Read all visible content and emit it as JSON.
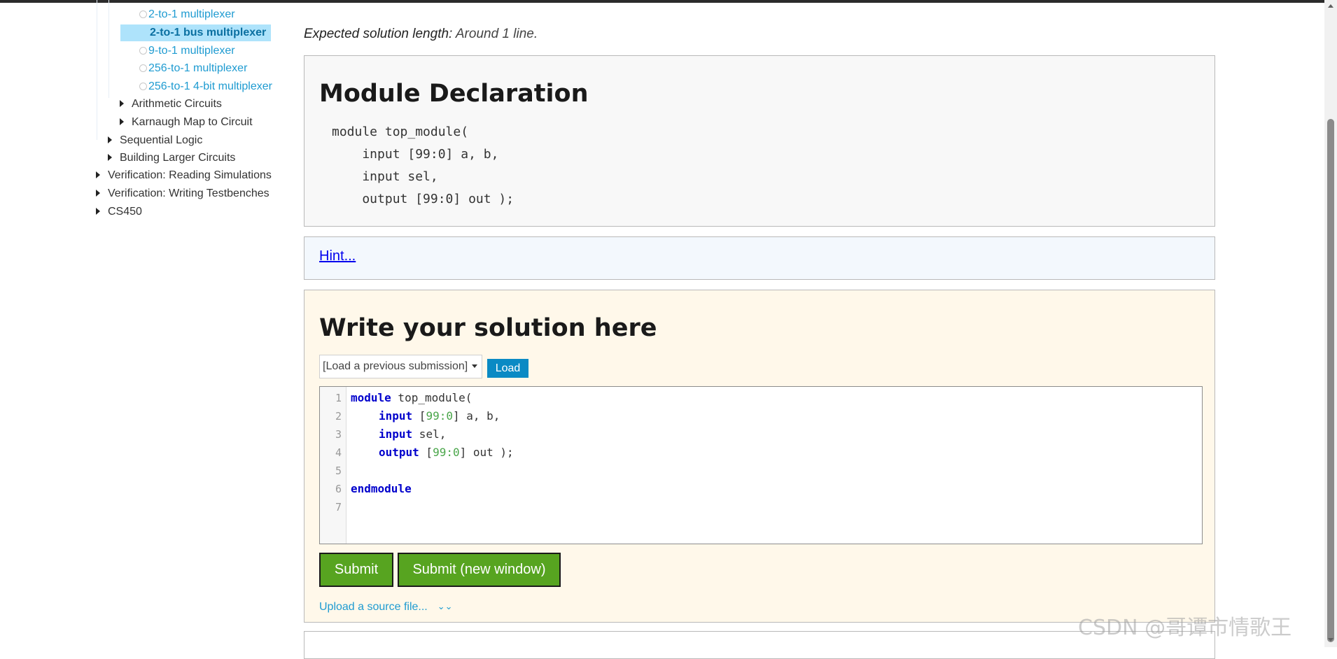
{
  "sidebar": {
    "items": [
      {
        "label": "2-to-1 multiplexer"
      },
      {
        "label": "2-to-1 bus multiplexer"
      },
      {
        "label": "9-to-1 multiplexer"
      },
      {
        "label": "256-to-1 multiplexer"
      },
      {
        "label": "256-to-1 4-bit multiplexer"
      },
      {
        "label": "Arithmetic Circuits"
      },
      {
        "label": "Karnaugh Map to Circuit"
      },
      {
        "label": "Sequential Logic"
      },
      {
        "label": "Building Larger Circuits"
      },
      {
        "label": "Verification: Reading Simulations"
      },
      {
        "label": "Verification: Writing Testbenches"
      },
      {
        "label": "CS450"
      }
    ]
  },
  "expected": {
    "label": "Expected solution length:",
    "value": " Around 1 line."
  },
  "declaration": {
    "title": "Module Declaration",
    "code": "module top_module( \n    input [99:0] a, b,\n    input sel,\n    output [99:0] out );"
  },
  "hint": {
    "label": "Hint..."
  },
  "solution": {
    "title": "Write your solution here",
    "select_label": "[Load a previous submission]",
    "load_label": "Load",
    "line_numbers": [
      "1",
      "2",
      "3",
      "4",
      "5",
      "6",
      "7"
    ],
    "code": {
      "l1_kw": "module",
      "l1_rest": " top_module(",
      "l2_kw": "input",
      "l2_a": " [",
      "l2_num": "99:0",
      "l2_b": "] a, b,",
      "l3_kw": "input",
      "l3_rest": " sel,",
      "l4_kw": "output",
      "l4_a": " [",
      "l4_num": "99:0",
      "l4_b": "] out );",
      "l6_kw": "endmodule"
    },
    "submit_label": "Submit",
    "submit_new_label": "Submit (new window)",
    "upload_label": "Upload a source file..."
  },
  "watermark": "CSDN @哥谭市情歌王",
  "colors": {
    "link": "#1e9bd1",
    "submit": "#57a420",
    "load": "#0a8ac4",
    "active_bg": "#aee3fb"
  }
}
